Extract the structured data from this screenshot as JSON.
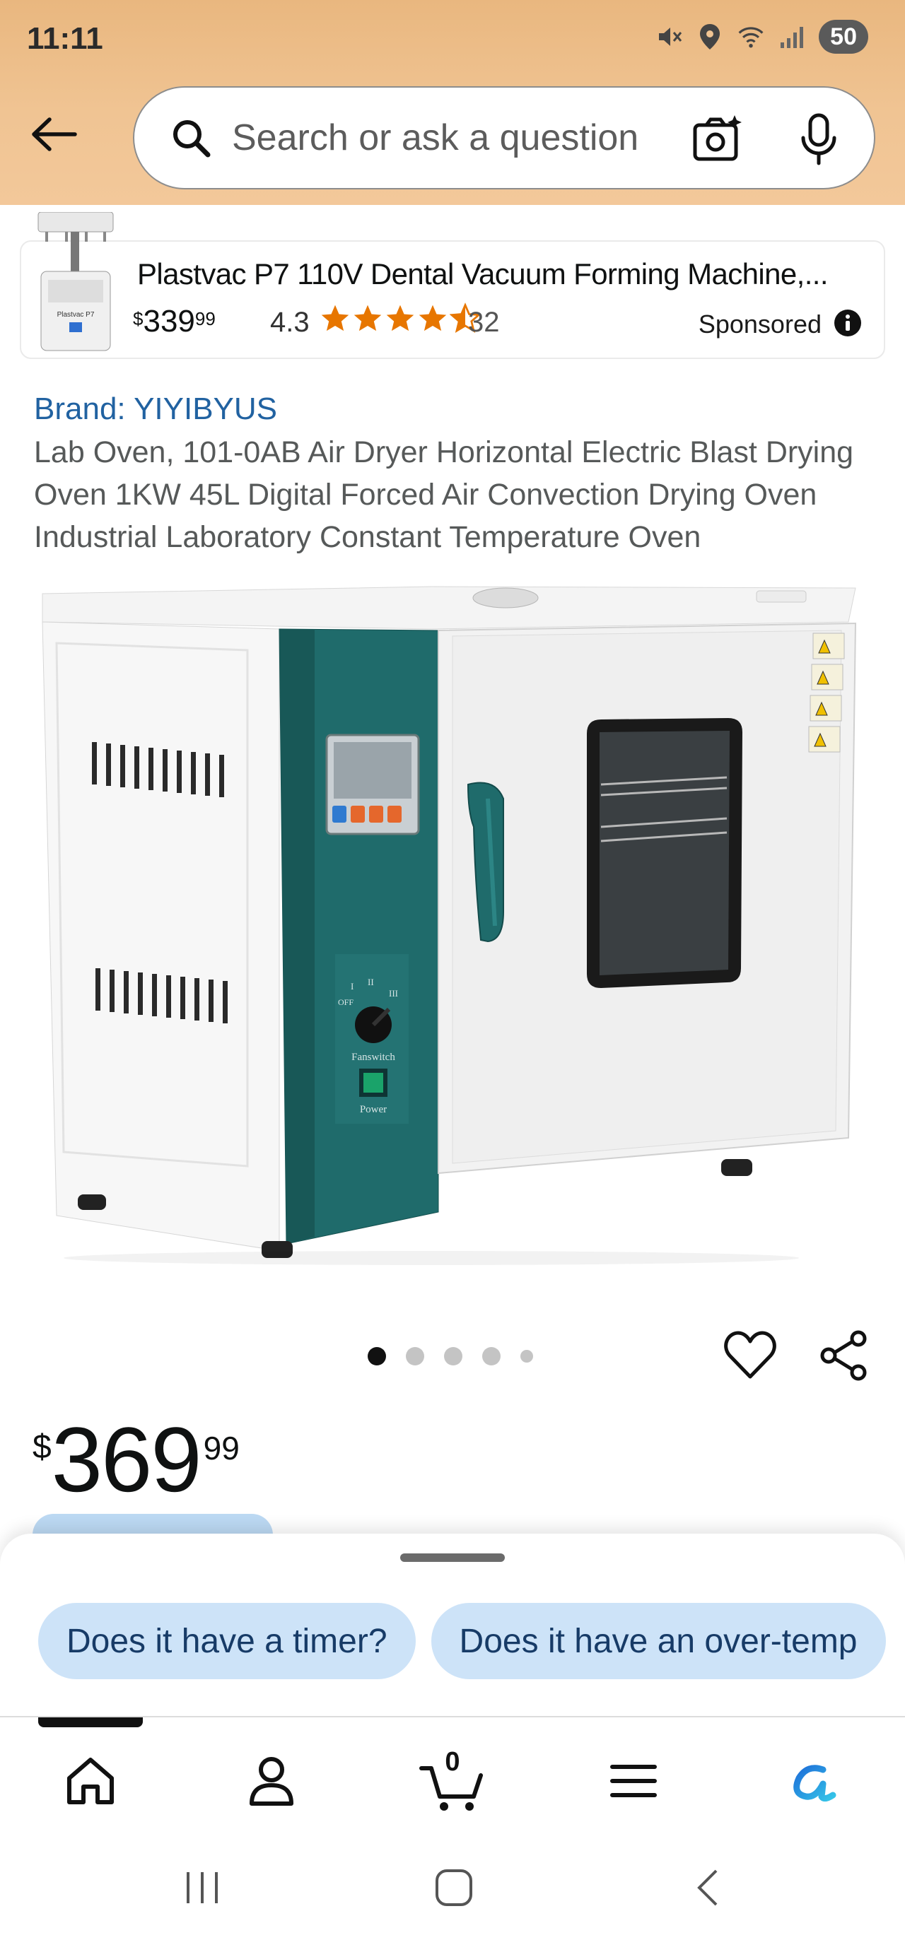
{
  "status_bar": {
    "time": "11:11",
    "battery": "50"
  },
  "search": {
    "placeholder": "Search or ask a question"
  },
  "sponsored": {
    "title": "Plastvac P7 110V Dental Vacuum Forming Machine,...",
    "price_currency": "$",
    "price_whole": "339",
    "price_fraction": "99",
    "rating": "4.3",
    "stars": 4.3,
    "review_count": "32",
    "label": "Sponsored",
    "thumb_text": "Plastvac P7"
  },
  "product": {
    "brand": "Brand: YIYIBYUS",
    "title": "Lab Oven, 101-0AB Air Dryer Horizontal Electric Blast Drying Oven 1KW 45L Digital Forced Air Convection Drying Oven Industrial Laboratory Constant Temperature Oven",
    "image_labels": {
      "switch_text": "Fanswitch",
      "power_text": "Power",
      "off_text": "OFF",
      "positions": [
        "I",
        "II",
        "III"
      ]
    },
    "price_currency": "$",
    "price_whole": "369",
    "price_fraction": "99",
    "carousel": {
      "count": 5,
      "active": 0
    }
  },
  "rufus": {
    "chips": [
      "Does it have a timer?",
      "Does it have an over-temp"
    ]
  },
  "nav": {
    "items": [
      "home-icon",
      "account-icon",
      "cart-icon",
      "menu-icon",
      "rufus-icon"
    ],
    "cart_count": "0"
  },
  "colors": {
    "header": "#f0c493",
    "brand_link": "#2162a1",
    "chip_bg": "#cde3f8",
    "oven_teal": "#1f6b6b",
    "star": "#e77600"
  }
}
